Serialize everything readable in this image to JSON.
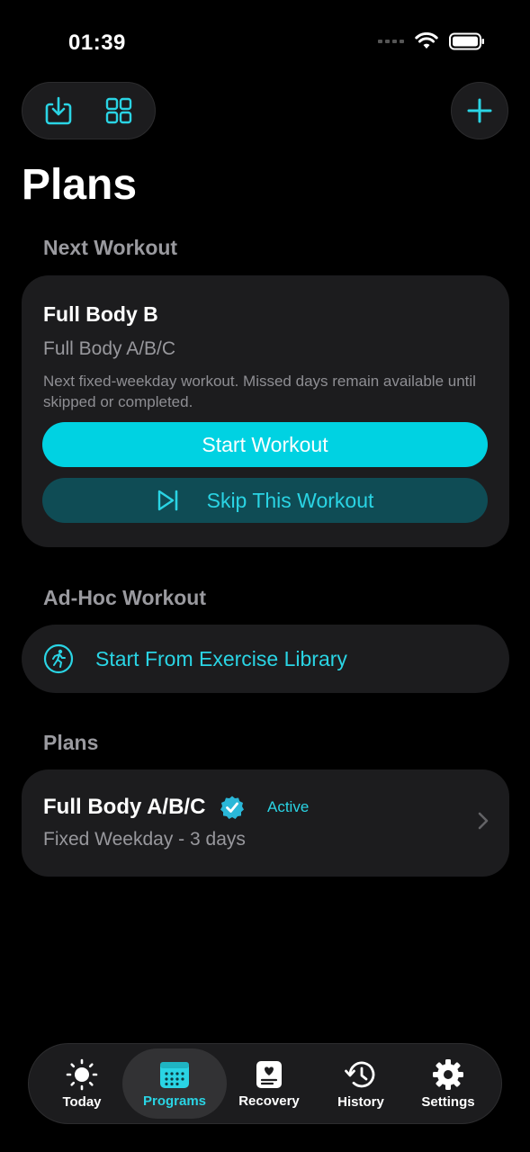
{
  "status": {
    "time": "01:39"
  },
  "header": {
    "title": "Plans",
    "icons": [
      "download-icon",
      "grid-icon",
      "plus-icon"
    ]
  },
  "next_workout": {
    "section_label": "Next Workout",
    "title": "Full Body B",
    "program": "Full Body A/B/C",
    "description": "Next fixed-weekday workout. Missed days remain available until skipped or completed.",
    "start_label": "Start Workout",
    "skip_label": "Skip This Workout"
  },
  "adhoc": {
    "section_label": "Ad-Hoc Workout",
    "button_label": "Start From Exercise Library"
  },
  "plans": {
    "section_label": "Plans",
    "items": [
      {
        "name": "Full Body A/B/C",
        "badge": "Active",
        "schedule": "Fixed Weekday - 3 days"
      }
    ]
  },
  "tabbar": {
    "selected": "Programs",
    "items": [
      {
        "label": "Today",
        "icon": "sun-icon"
      },
      {
        "label": "Programs",
        "icon": "calendar-icon"
      },
      {
        "label": "Recovery",
        "icon": "recovery-icon"
      },
      {
        "label": "History",
        "icon": "history-icon"
      },
      {
        "label": "Settings",
        "icon": "gear-icon"
      }
    ]
  },
  "colors": {
    "accent": "#00d2e2",
    "card": "#1c1c1e",
    "background": "#000000"
  }
}
